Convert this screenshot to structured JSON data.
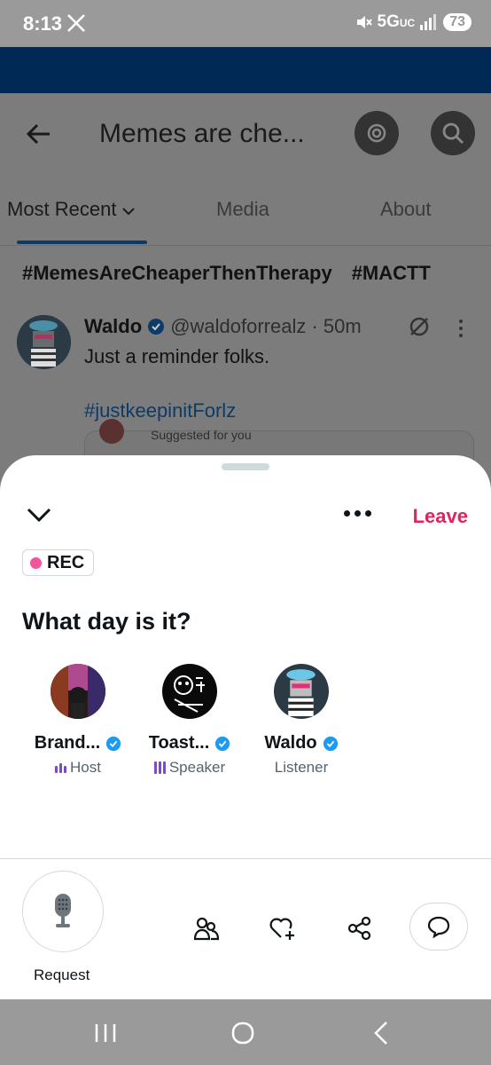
{
  "status_bar": {
    "time": "8:13",
    "network": "5G",
    "network_sub": "UC",
    "battery": "73"
  },
  "community": {
    "title": "Memes are che...",
    "tabs": [
      {
        "label": "Most Recent"
      },
      {
        "label": "Media"
      },
      {
        "label": "About"
      }
    ],
    "hashtags": [
      "#MemesAreCheaperThenTherapy",
      "#MACTT"
    ]
  },
  "tweet": {
    "name": "Waldo",
    "handle": "@waldoforrealz · 50m",
    "text": "Just a reminder folks.",
    "tag": "#justkeepinitForlz",
    "card_label": "Suggested for you"
  },
  "space": {
    "leave_label": "Leave",
    "rec_label": "REC",
    "title": "What day is it?",
    "participants": [
      {
        "name": "Brand...",
        "role": "Host"
      },
      {
        "name": "Toast...",
        "role": "Speaker"
      },
      {
        "name": "Waldo",
        "role": "Listener"
      }
    ],
    "request_label": "Request"
  },
  "colors": {
    "leave": "#e0245e",
    "rec_dot": "#f0569b",
    "verified": "#1d9bf0",
    "speaking_bars": "#794bc4"
  }
}
